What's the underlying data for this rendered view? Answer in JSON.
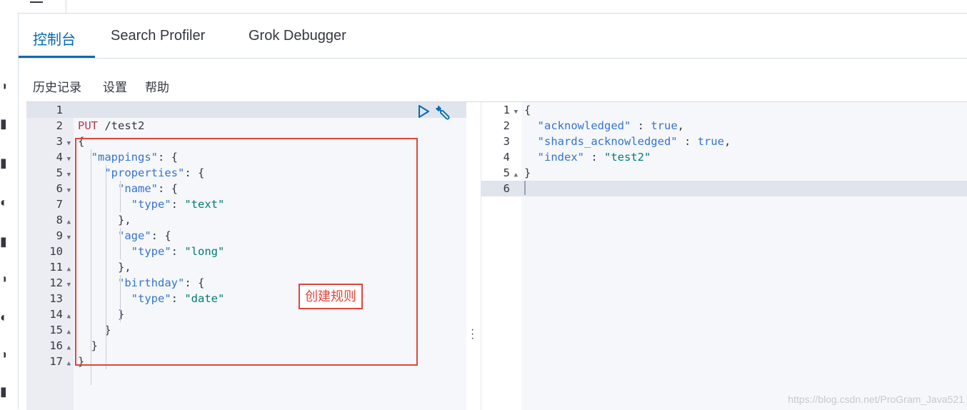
{
  "tabs": [
    {
      "label": "控制台",
      "active": true
    },
    {
      "label": "Search Profiler",
      "active": false
    },
    {
      "label": "Grok Debugger",
      "active": false
    }
  ],
  "menu": {
    "history": "历史记录",
    "settings": "设置",
    "help": "帮助"
  },
  "request_editor": {
    "line_numbers": [
      "1",
      "2",
      "3",
      "4",
      "5",
      "6",
      "7",
      "8",
      "9",
      "10",
      "11",
      "12",
      "13",
      "14",
      "15",
      "16",
      "17"
    ],
    "lines": [
      "",
      "PUT /test2",
      "{",
      "  \"mappings\": {",
      "    \"properties\": {",
      "      \"name\": {",
      "        \"type\": \"text\"",
      "      },",
      "      \"age\": {",
      "        \"type\": \"long\"",
      "      },",
      "      \"birthday\": {",
      "        \"type\": \"date\"",
      "      }",
      "    }",
      "  }",
      "}"
    ]
  },
  "response_editor": {
    "line_numbers": [
      "1",
      "2",
      "3",
      "4",
      "5",
      "6"
    ],
    "lines": [
      "{",
      "  \"acknowledged\" : true,",
      "  \"shards_acknowledged\" : true,",
      "  \"index\" : \"test2\"",
      "}",
      ""
    ]
  },
  "annotation": "创建规则",
  "watermark": "https://blog.csdn.net/ProGram_Java521",
  "colors": {
    "accent": "#006bb4",
    "annotation_red": "#e2453c",
    "string_green": "#017d73",
    "method_red": "#b5344a",
    "key_blue": "#3574d1"
  },
  "icons": [
    "hamburger-icon",
    "play-icon",
    "wrench-icon",
    "vertical-dots-icon"
  ]
}
